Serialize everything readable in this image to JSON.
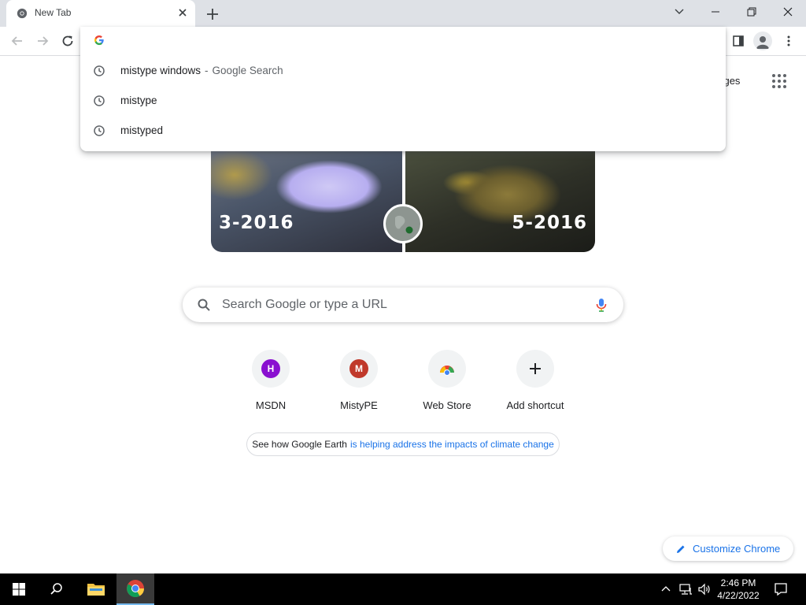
{
  "browser": {
    "tab_title": "New Tab"
  },
  "omnibox": {
    "value": "",
    "suggestions": [
      {
        "text": "mistype windows",
        "separator": "-",
        "suffix": "Google Search"
      },
      {
        "text": "mistype"
      },
      {
        "text": "mistyped"
      }
    ]
  },
  "ntp": {
    "images_link": "nages",
    "doodle": {
      "left_label": "3-2016",
      "right_label": "5-2016"
    },
    "search_placeholder": "Search Google or type a URL",
    "shortcuts": [
      {
        "label": "MSDN",
        "letter": "H",
        "color": "#8a10d0"
      },
      {
        "label": "MistyPE",
        "letter": "M",
        "color": "#c0392b"
      },
      {
        "label": "Web Store",
        "icon": "web-store-icon"
      },
      {
        "label": "Add shortcut",
        "icon": "plus-icon"
      }
    ],
    "promo": {
      "plain": "See how Google Earth",
      "link": "is helping address the impacts of climate change"
    },
    "customize_label": "Customize Chrome"
  },
  "taskbar": {
    "time": "2:46 PM",
    "date": "4/22/2022"
  },
  "colors": {
    "accent": "#1a73e8",
    "tabstrip": "#dee1e6",
    "taskbar": "#000000"
  }
}
